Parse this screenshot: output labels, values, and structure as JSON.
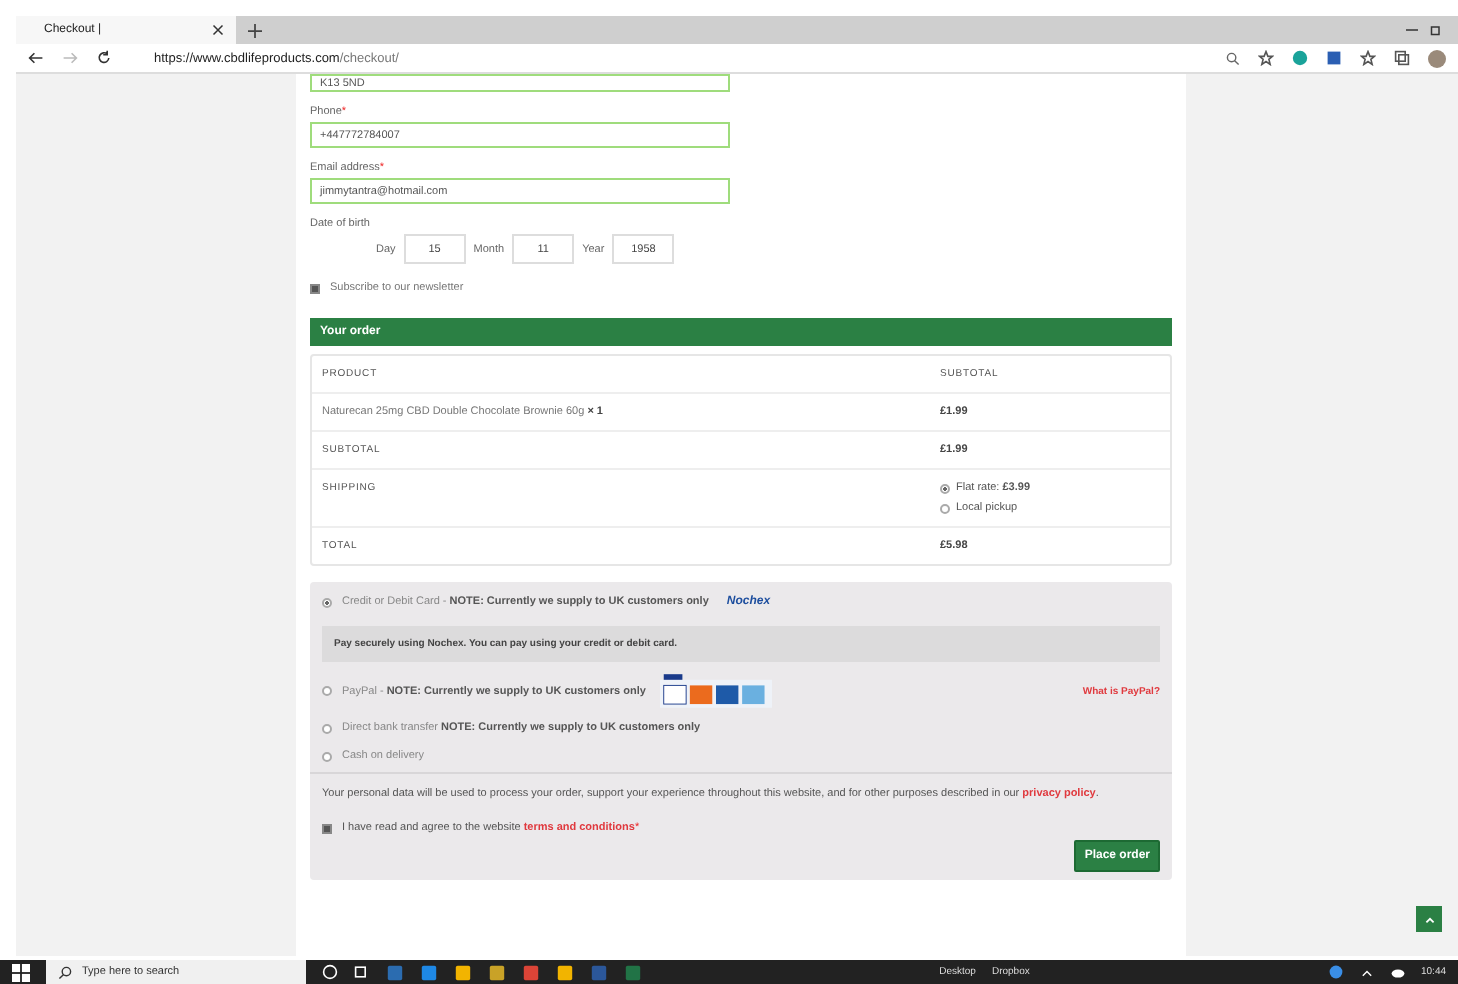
{
  "browser": {
    "tab_title": "Checkout |",
    "url_host": "https://www.cbdlifeproducts.com",
    "url_path": "/checkout/"
  },
  "form": {
    "fields": [
      {
        "value": "K13 5ND"
      },
      {
        "label": "Phone",
        "required_mark": "*",
        "value": "+447772784007"
      },
      {
        "label": "Email address",
        "required_mark": "*",
        "value": "jimmytantra@hotmail.com"
      }
    ],
    "dob": {
      "label": "Date of birth",
      "parts": [
        {
          "label": "Day",
          "value": "15"
        },
        {
          "label": "Month",
          "value": "11"
        },
        {
          "label": "Year",
          "value": "1958"
        }
      ]
    },
    "newsletter": {
      "label": "Subscribe to our newsletter",
      "checked": true
    }
  },
  "order": {
    "title": "Your order",
    "columns": [
      "PRODUCT",
      "SUBTOTAL"
    ],
    "items": [
      {
        "name": "Naturecan 25mg CBD Double Chocolate Brownie 60g",
        "qty": "× 1",
        "price": "£1.99"
      }
    ],
    "subtotal": {
      "label": "SUBTOTAL",
      "value": "£1.99"
    },
    "shipping": {
      "label": "SHIPPING",
      "options": [
        {
          "label": "Flat rate: **£3.99**",
          "selected": true
        },
        {
          "label": "Local pickup",
          "selected": false
        }
      ]
    },
    "total": {
      "label": "TOTAL",
      "value": "£5.98"
    }
  },
  "payment": {
    "methods": [
      {
        "kind": "nochex",
        "label": "Credit or Debit Card - **NOTE: Currently we supply to UK customers only**",
        "selected": true,
        "logo": "Nochex",
        "description": "Pay securely using Nochex. You can pay using your credit or debit card."
      },
      {
        "kind": "paypal",
        "label": "PayPal - **NOTE: Currently we supply to UK customers only**",
        "selected": false,
        "link": "What is PayPal?"
      },
      {
        "kind": "plain",
        "label": "Direct bank transfer **NOTE: Currently we supply to UK customers only**",
        "selected": false
      },
      {
        "kind": "plain",
        "label": "Cash on delivery",
        "selected": false
      }
    ],
    "privacy": {
      "text": "Your personal data will be used to process your order, support your experience throughout this website, and for other purposes described in our",
      "link": "privacy policy",
      "end": "."
    },
    "terms": {
      "text": "I have read and agree to the website",
      "link": "terms and conditions",
      "required_mark": "*",
      "checked": true
    },
    "button": "Place order"
  },
  "taskbar": {
    "search_placeholder": "Type here to search",
    "desktop": "Desktop",
    "dropbox": "Dropbox",
    "time": "10:44"
  }
}
